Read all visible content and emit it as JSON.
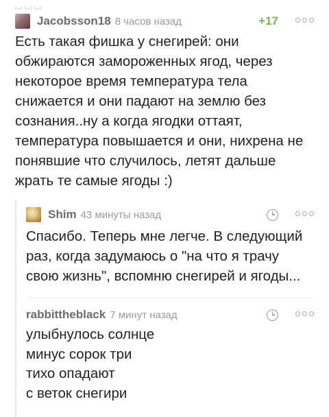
{
  "comments": [
    {
      "username": "Jacobsson18",
      "time": "8 часов назад",
      "rating": "+17",
      "text": "Есть такая фишка у снегирей: они обжираются замороженных ягод, через некоторое время температура тела снижается и они падают на землю без сознания..ну а когда ягодки оттаят, температура повышается и они, нихрена не понявшие что случилось, летят дальше жрать те самые ягоды :)"
    },
    {
      "username": "Shim",
      "time": "43 минуты назад",
      "text": "Спасибо. Теперь мне легче. В следующий раз, когда задумаюсь о \"на что я трачу свою жизнь\", вспомню снегирей и ягоды..."
    },
    {
      "username": "rabbittheblack",
      "time": "7 минут назад",
      "text": "улыбнулось солнце\nминус сорок три\nтихо опадают\nс веток снегири"
    }
  ]
}
